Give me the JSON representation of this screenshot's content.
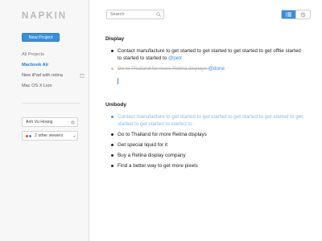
{
  "app": {
    "logo": "NAPKIN"
  },
  "sidebar": {
    "new_project_label": "New Project",
    "items": [
      {
        "label": "All Projects"
      },
      {
        "label": "Macbook Air"
      },
      {
        "label": "New iPad with retina"
      },
      {
        "label": "Mac OS X Lion"
      }
    ],
    "user_name": "Anh Vu Hoang",
    "viewers_label": "2 other viewers",
    "viewer_colors": [
      "#e0473c",
      "#3b8fd9"
    ]
  },
  "search": {
    "placeholder": "Search"
  },
  "sections": [
    {
      "title": "Display",
      "items": [
        {
          "text": "Contact manufacture to get started to get started to get started to get offtie started to started to started to ",
          "tag": "@petr",
          "state": "normal"
        },
        {
          "text": "Go to Thailand for more Retina displays ",
          "tag": "@done",
          "state": "done"
        }
      ]
    },
    {
      "title": "Unibody",
      "items": [
        {
          "text": "Contact manufacture to get started to get started to get started to get started to get started to get started to started to",
          "tag": "",
          "state": "selected"
        },
        {
          "text": "Go to Thailand for more Retina displays",
          "tag": "",
          "state": "normal"
        },
        {
          "text": "Get special liquid for it",
          "tag": "",
          "state": "normal"
        },
        {
          "text": "Buy a Retina display company",
          "tag": "",
          "state": "normal"
        },
        {
          "text": "Find a better way to get more pixels",
          "tag": "",
          "state": "normal"
        }
      ]
    }
  ],
  "colors": {
    "accent": "#3b8fd9",
    "done": "#b0b0b0",
    "selected_text": "#8ab8e3"
  },
  "icons": {
    "list_view": "list-icon",
    "history_view": "history-icon",
    "search": "search-icon",
    "trash": "trash-icon"
  }
}
